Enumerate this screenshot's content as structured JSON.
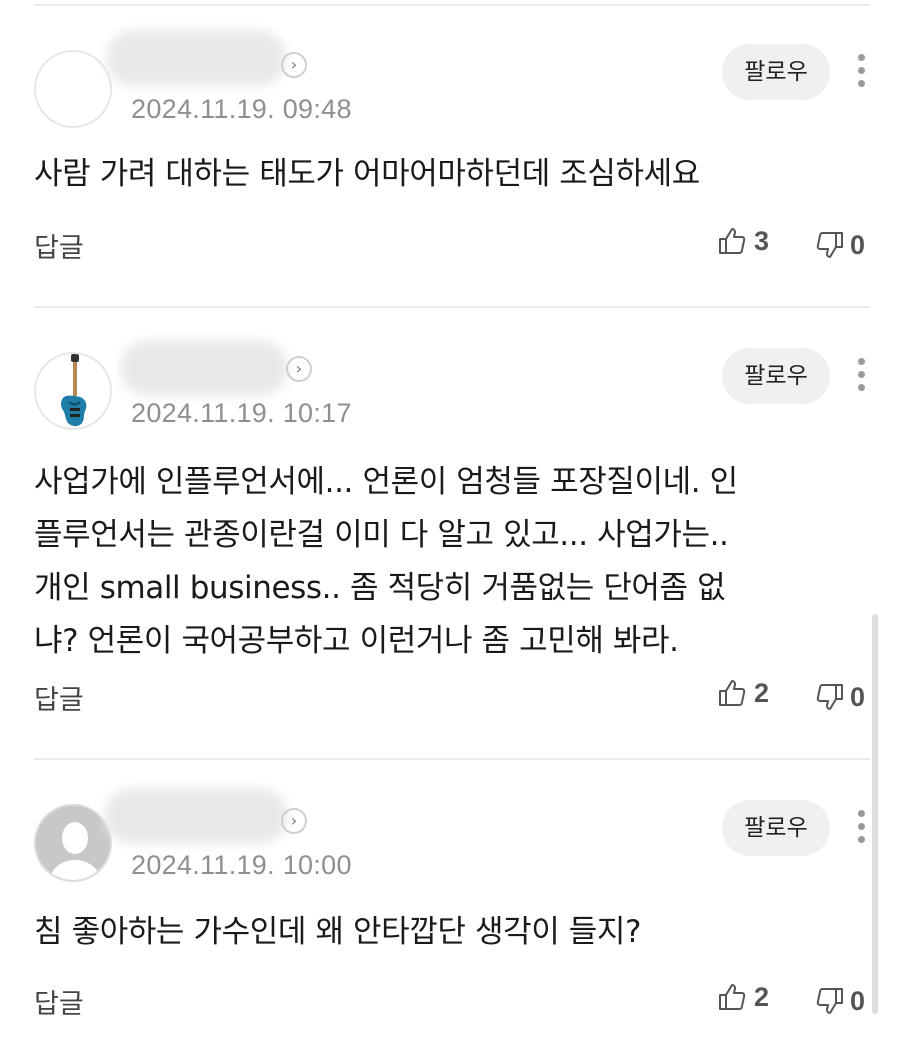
{
  "comments": [
    {
      "date": "2024.11.19. 09:48",
      "follow_label": "팔로우",
      "text_lines": [
        "사람 가려 대하는 태도가 어마어마하던데 조심하세요"
      ],
      "reply_label": "답글",
      "likes": "3",
      "dislikes": "0"
    },
    {
      "date": "2024.11.19. 10:17",
      "follow_label": "팔로우",
      "text_lines": [
        "사업가에 인플루언서에... 언론이 엄청들 포장질이네. 인",
        "플루언서는 관종이란걸 이미 다 알고 있고... 사업가는..",
        "개인 small business.. 좀 적당히 거품없는 단어좀 없",
        "냐? 언론이 국어공부하고 이런거나 좀 고민해 봐라."
      ],
      "reply_label": "답글",
      "likes": "2",
      "dislikes": "0"
    },
    {
      "date": "2024.11.19. 10:00",
      "follow_label": "팔로우",
      "text_lines": [
        "침 좋아하는 가수인데 왜 안타깝단 생각이 들지?"
      ],
      "reply_label": "답글",
      "likes": "2",
      "dislikes": "0"
    }
  ],
  "icons": {
    "profile_arrow": "chevron-right-icon",
    "more": "more-vertical-icon",
    "like": "thumbs-up-icon",
    "dislike": "thumbs-down-icon"
  },
  "colors": {
    "date": "#8f8f8f",
    "follow_bg": "#f0f0f0",
    "divider": "#ececec"
  }
}
